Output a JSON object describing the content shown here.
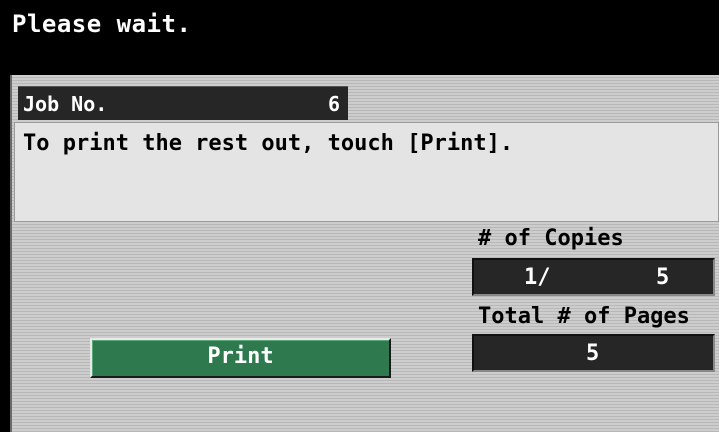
{
  "header": {
    "title": "Please wait."
  },
  "job": {
    "label": "Job No.",
    "number": "6"
  },
  "message": {
    "text": "To print the rest out, touch [Print]."
  },
  "copies": {
    "label": "# of Copies",
    "current": "1/",
    "total": "5"
  },
  "pages": {
    "label": "Total # of Pages",
    "total": "5"
  },
  "actions": {
    "print_label": "Print"
  },
  "colors": {
    "header_bg": "#000000",
    "panel_bg": "#cdcdcd",
    "message_bg": "#e4e4e4",
    "value_box_bg": "#262626",
    "print_button": "#2e7a4e"
  }
}
